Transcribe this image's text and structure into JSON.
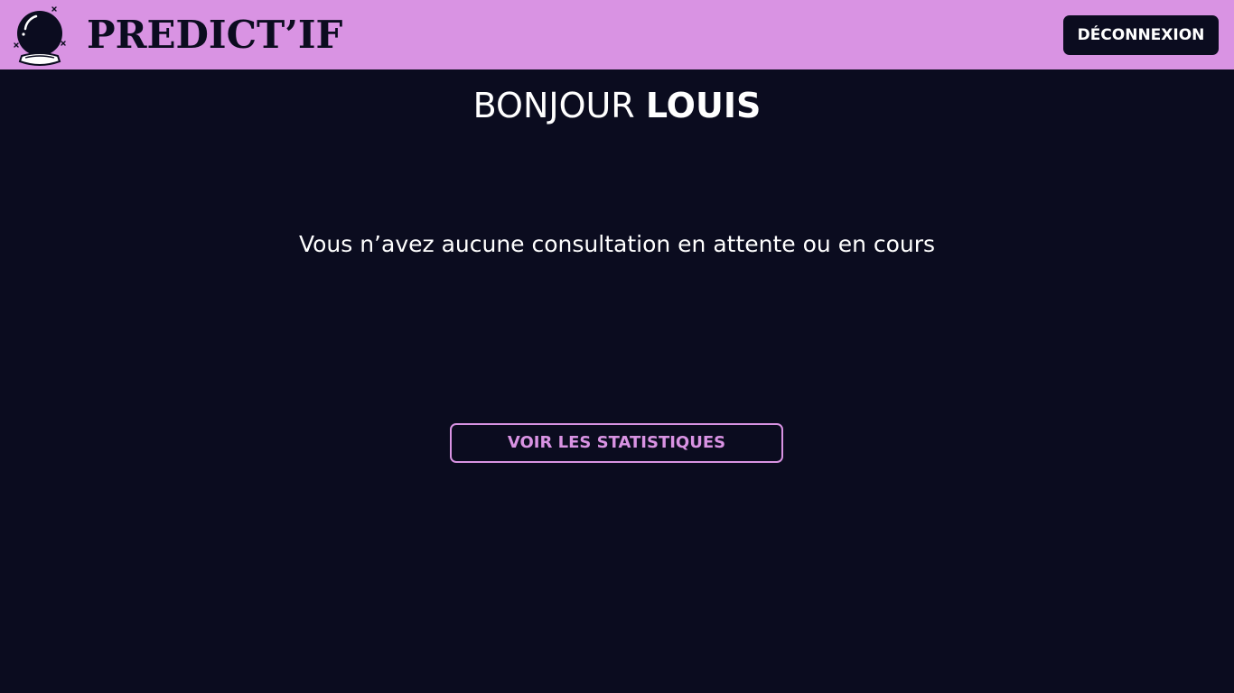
{
  "colors": {
    "accent": "#d993e3",
    "background": "#0b0c1f",
    "text": "#ffffff"
  },
  "header": {
    "logo_icon": "crystal-ball-icon",
    "brand": "PREDICT’IF",
    "logout_label": "DÉCONNEXION"
  },
  "main": {
    "greeting_prefix": "BONJOUR",
    "user_name": "LOUIS",
    "message": "Vous n’avez aucune consultation en attente ou en cours",
    "stats_button_label": "VOIR LES STATISTIQUES"
  }
}
